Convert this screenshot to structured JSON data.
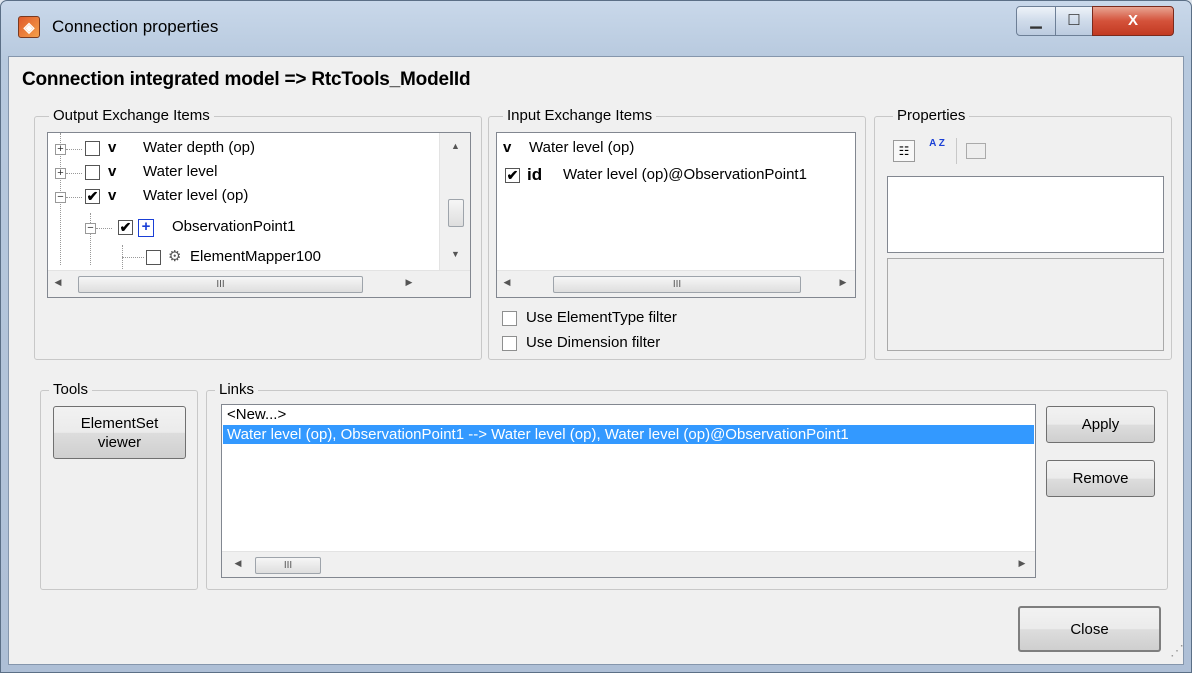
{
  "window": {
    "title": "Connection properties",
    "minimize_glyph": "▁",
    "maximize_glyph": "☐",
    "close_glyph": "X"
  },
  "heading": "Connection integrated model => RtcTools_ModelId",
  "output_items": {
    "legend": "Output Exchange Items",
    "rows": [
      {
        "expander": "+",
        "checked": false,
        "badge": "v",
        "label": "Water depth (op)"
      },
      {
        "expander": "+",
        "checked": false,
        "badge": "v",
        "label": "Water level"
      },
      {
        "expander": "−",
        "checked": true,
        "badge": "v",
        "label": "Water level (op)"
      },
      {
        "expander": "−",
        "checked": true,
        "badge": "+",
        "label": "ObservationPoint1"
      },
      {
        "expander": "",
        "checked": false,
        "badge": "",
        "label": "ElementMapper100"
      }
    ],
    "scroll_glyph": "III"
  },
  "input_items": {
    "legend": "Input Exchange Items",
    "parent": {
      "badge": "v",
      "label": "Water level (op)"
    },
    "child": {
      "checked": true,
      "badge": "id",
      "label": "Water level (op)@ObservationPoint1"
    },
    "scroll_glyph": "III",
    "filter_element_type": "Use ElementType filter",
    "filter_dimension": "Use Dimension filter"
  },
  "properties": {
    "legend": "Properties",
    "sort_az_glyph": "A Z"
  },
  "tools": {
    "legend": "Tools",
    "element_set_viewer_label_1": "ElementSet",
    "element_set_viewer_label_2": "viewer"
  },
  "links": {
    "legend": "Links",
    "items": [
      {
        "text": "<New...>",
        "selected": false
      },
      {
        "text": "Water level (op), ObservationPoint1 --> Water level (op), Water level (op)@ObservationPoint1",
        "selected": true
      }
    ],
    "scroll_glyph": "III",
    "apply_label": "Apply",
    "remove_label": "Remove"
  },
  "close_label": "Close",
  "colors": {
    "selection": "#3399ff",
    "badge_blue": "#1a3fd6"
  }
}
